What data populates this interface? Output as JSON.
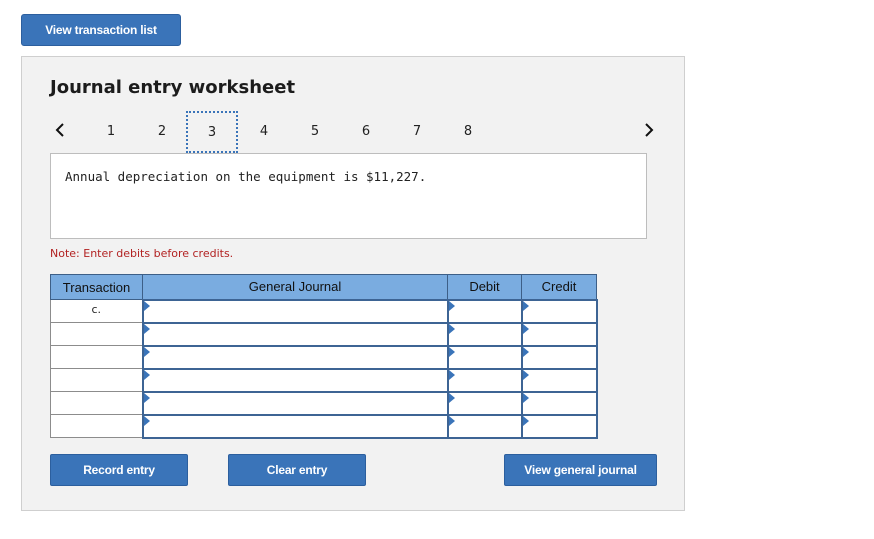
{
  "top_button": {
    "label": "View transaction list"
  },
  "worksheet": {
    "title": "Journal entry worksheet",
    "pages": [
      "1",
      "2",
      "3",
      "4",
      "5",
      "6",
      "7",
      "8"
    ],
    "active_page": "3",
    "prev_icon": "chevron-left-icon",
    "next_icon": "chevron-right-icon",
    "description": "Annual depreciation on the equipment is $11,227.",
    "note": "Note: Enter debits before credits."
  },
  "table": {
    "headers": {
      "transaction": "Transaction",
      "journal": "General Journal",
      "debit": "Debit",
      "credit": "Credit"
    },
    "rows": [
      {
        "transaction": "c.",
        "account": "",
        "debit": "",
        "credit": ""
      },
      {
        "transaction": "",
        "account": "",
        "debit": "",
        "credit": ""
      },
      {
        "transaction": "",
        "account": "",
        "debit": "",
        "credit": ""
      },
      {
        "transaction": "",
        "account": "",
        "debit": "",
        "credit": ""
      },
      {
        "transaction": "",
        "account": "",
        "debit": "",
        "credit": ""
      },
      {
        "transaction": "",
        "account": "",
        "debit": "",
        "credit": ""
      }
    ]
  },
  "buttons": {
    "record": "Record entry",
    "clear": "Clear entry",
    "view_journal": "View general journal"
  },
  "colors": {
    "button": "#3a74b9",
    "header": "#7aace0",
    "note": "#b22222",
    "panel": "#f2f2f2"
  }
}
